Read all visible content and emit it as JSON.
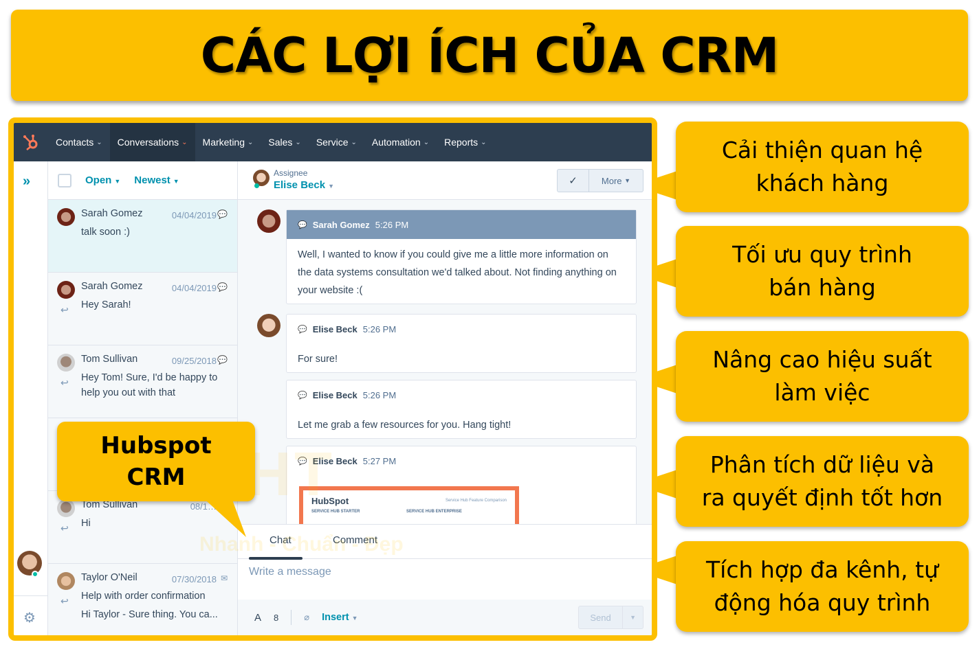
{
  "title": "CÁC LỢI ÍCH CỦA CRM",
  "app": {
    "nav": {
      "logo": "hubspot-sprocket-icon",
      "items": [
        {
          "label": "Contacts",
          "active": false
        },
        {
          "label": "Conversations",
          "active": true
        },
        {
          "label": "Marketing",
          "active": false
        },
        {
          "label": "Sales",
          "active": false
        },
        {
          "label": "Service",
          "active": false
        },
        {
          "label": "Automation",
          "active": false
        },
        {
          "label": "Reports",
          "active": false
        }
      ],
      "chevron": "⌄"
    },
    "rail": {
      "expand_icon": "»",
      "settings_icon": "⚙"
    },
    "list": {
      "filter_status": "Open",
      "filter_sort": "Newest",
      "conversations": [
        {
          "name": "Sarah Gomez",
          "date": "04/04/2019",
          "channel": "chat",
          "preview": "talk soon :)",
          "replied": false,
          "active": true
        },
        {
          "name": "Sarah Gomez",
          "date": "04/04/2019",
          "channel": "chat",
          "preview": "Hey Sarah!",
          "replied": true,
          "active": false
        },
        {
          "name": "Tom Sullivan",
          "date": "09/25/2018",
          "channel": "chat",
          "preview": "Hey Tom! Sure, I'd be happy to help you out with that",
          "replied": true,
          "active": false
        },
        {
          "name": "",
          "date": "",
          "channel": "",
          "preview": "",
          "replied": false,
          "active": false
        },
        {
          "name": "Tom Sullivan",
          "date": "08/1…",
          "channel": "chat",
          "preview": "Hi",
          "replied": true,
          "active": false
        },
        {
          "name": "Taylor O'Neil",
          "date": "07/30/2018",
          "channel": "email",
          "preview": "Help with order confirmation",
          "preview2": "Hi Taylor - Sure thing. You ca...",
          "replied": true,
          "active": false
        }
      ]
    },
    "thread": {
      "assignee_label": "Assignee",
      "assignee_name": "Elise Beck",
      "check_icon": "✓",
      "more_label": "More",
      "messages": [
        {
          "author": "Sarah Gomez",
          "time": "5:26 PM",
          "body": "Well, I wanted to know if you could give me a little more information on the data systems consultation we'd talked about. Not finding anything on your website :(",
          "visitor": true
        },
        {
          "author": "Elise Beck",
          "time": "5:26 PM",
          "body": "For sure!",
          "visitor": false
        },
        {
          "author": "Elise Beck",
          "time": "5:26 PM",
          "body": "Let me grab a few resources for you. Hang tight!",
          "visitor": false
        },
        {
          "author": "Elise Beck",
          "time": "5:27 PM",
          "body": "",
          "visitor": false
        }
      ],
      "attachment": {
        "logo": "HubSpot",
        "header_right": "Service Hub Feature Comparison",
        "col1": "SERVICE HUB STARTER",
        "col2": "SERVICE HUB ENTERPRISE"
      }
    },
    "composer": {
      "tab_chat": "Chat",
      "tab_comment": "Comment",
      "placeholder": "Write a message",
      "format_icon": "A",
      "link_icon": "8",
      "attach_icon": "📎",
      "insert_label": "Insert",
      "send_label": "Send"
    }
  },
  "callout": {
    "line1": "Hubspot",
    "line2": "CRM"
  },
  "benefits": [
    {
      "line1": "Cải thiện quan hệ",
      "line2": "khách hàng"
    },
    {
      "line1": "Tối ưu quy trình",
      "line2": "bán hàng"
    },
    {
      "line1": "Nâng cao hiệu suất",
      "line2": "làm việc"
    },
    {
      "line1": "Phân tích dữ liệu và",
      "line2": "ra quyết định tốt hơn"
    },
    {
      "line1": "Tích hợp đa kênh, tự",
      "line2": "động hóa quy trình"
    }
  ],
  "watermark": {
    "brand": "CHT",
    "slogan": "Nhanh - Chuẩn - Đẹp"
  },
  "colors": {
    "accent_yellow": "#fcbf00",
    "nav_bg": "#2d3e50",
    "teal": "#0091ae",
    "orange": "#ff7a59"
  }
}
